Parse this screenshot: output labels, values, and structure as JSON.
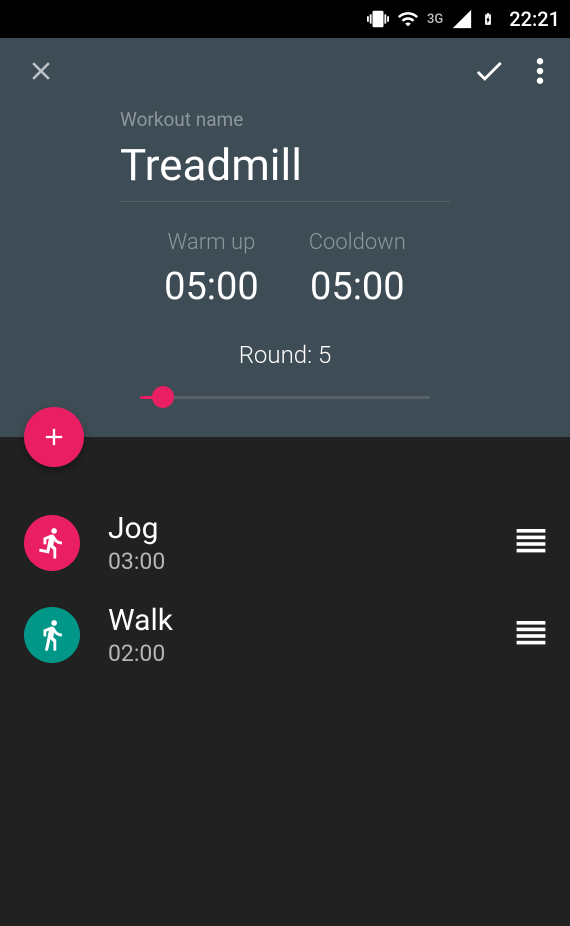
{
  "status_bar": {
    "network": "3G",
    "time": "22:21"
  },
  "form": {
    "name_label": "Workout name",
    "name_value": "Treadmill",
    "warmup_label": "Warm up",
    "warmup_value": "05:00",
    "cooldown_label": "Cooldown",
    "cooldown_value": "05:00",
    "round_label": "Round: 5"
  },
  "exercises": [
    {
      "name": "Jog",
      "duration": "03:00",
      "color": "pink",
      "icon": "running"
    },
    {
      "name": "Walk",
      "duration": "02:00",
      "color": "teal",
      "icon": "walking"
    }
  ]
}
